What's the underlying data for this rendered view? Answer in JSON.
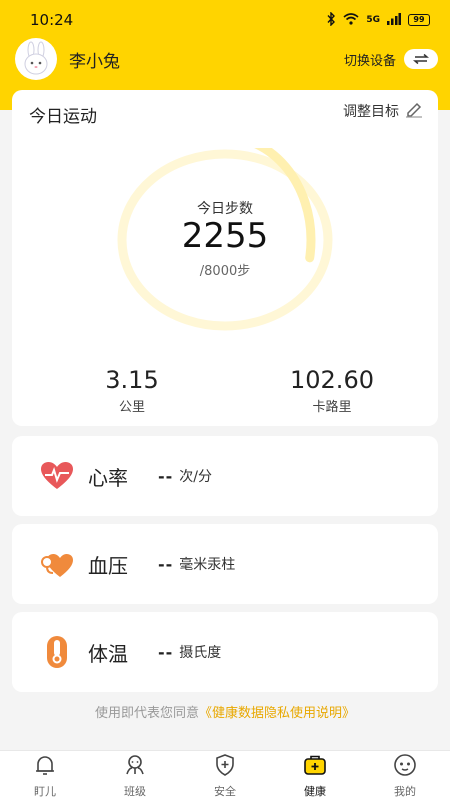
{
  "status_bar": {
    "time": "10:24",
    "network": "5G",
    "battery": "99"
  },
  "header": {
    "username": "李小兔",
    "switch_label": "切换设备"
  },
  "activity": {
    "title": "今日运动",
    "adjust_label": "调整目标",
    "steps_label": "今日步数",
    "steps_value": "2255",
    "steps_target": "/8000步",
    "progress_fraction": 0.28,
    "distance_value": "3.15",
    "distance_unit": "公里",
    "calories_value": "102.60",
    "calories_unit": "卡路里"
  },
  "metrics": [
    {
      "name": "心率",
      "value": "--",
      "unit": "次/分",
      "icon": "heart-rate-icon"
    },
    {
      "name": "血压",
      "value": "--",
      "unit": "毫米汞柱",
      "icon": "blood-pressure-icon"
    },
    {
      "name": "体温",
      "value": "--",
      "unit": "摄氏度",
      "icon": "thermometer-icon"
    }
  ],
  "consent": {
    "prefix": "使用即代表您同意",
    "link": "《健康数据隐私使用说明》"
  },
  "tabs": [
    {
      "label": "盯儿",
      "icon": "bell-icon"
    },
    {
      "label": "班级",
      "icon": "class-icon"
    },
    {
      "label": "安全",
      "icon": "shield-icon"
    },
    {
      "label": "健康",
      "icon": "health-kit-icon",
      "active": true
    },
    {
      "label": "我的",
      "icon": "profile-face-icon"
    }
  ],
  "colors": {
    "brand_yellow": "#ffd400",
    "accent_red": "#e8585a",
    "accent_orange": "#f08a3c",
    "link": "#e8a800"
  }
}
